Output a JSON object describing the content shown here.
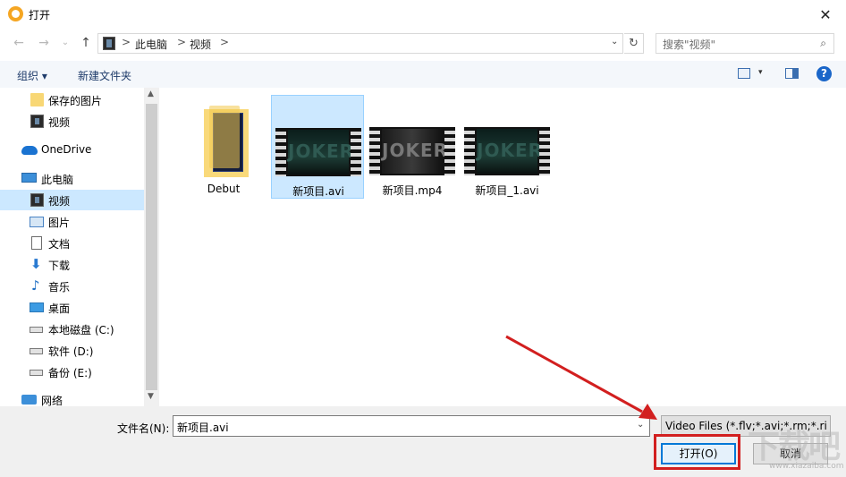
{
  "window": {
    "title": "打开",
    "close_glyph": "✕"
  },
  "addressbar": {
    "back_glyph": "←",
    "forward_glyph": "→",
    "recent_glyph": "⌄",
    "up_glyph": "↑",
    "crumbs": [
      "此电脑",
      "视频"
    ],
    "sep": ">",
    "dropdown_glyph": "⌄",
    "refresh_glyph": "↻"
  },
  "search": {
    "placeholder": "搜索\"视频\"",
    "icon": "search-icon"
  },
  "toolbar": {
    "organize_label": "组织 ▾",
    "new_folder_label": "新建文件夹",
    "view_drop_glyph": "▾",
    "help_label": "?"
  },
  "nav": {
    "items": [
      {
        "label": "保存的图片",
        "icon": "folder-icon"
      },
      {
        "label": "视频",
        "icon": "video-icon"
      },
      {
        "label": "OneDrive",
        "icon": "cloud-icon"
      },
      {
        "label": "此电脑",
        "icon": "computer-icon"
      },
      {
        "label": "视频",
        "icon": "video-icon",
        "selected": true
      },
      {
        "label": "图片",
        "icon": "picture-icon"
      },
      {
        "label": "文档",
        "icon": "document-icon"
      },
      {
        "label": "下载",
        "icon": "download-icon",
        "glyph": "⬇"
      },
      {
        "label": "音乐",
        "icon": "music-icon",
        "glyph": "♪"
      },
      {
        "label": "桌面",
        "icon": "desktop-icon"
      },
      {
        "label": "本地磁盘 (C:)",
        "icon": "drive-icon"
      },
      {
        "label": "软件 (D:)",
        "icon": "drive-icon"
      },
      {
        "label": "备份 (E:)",
        "icon": "drive-icon"
      },
      {
        "label": "网络",
        "icon": "network-icon"
      }
    ],
    "scroll_up_glyph": "▲",
    "scroll_down_glyph": "▼"
  },
  "files": [
    {
      "name": "Debut",
      "type": "folder"
    },
    {
      "name": "新项目.avi",
      "type": "video",
      "selected": true,
      "thumb_text": "JOKER"
    },
    {
      "name": "新项目.mp4",
      "type": "video",
      "thumb_text": "JOKER"
    },
    {
      "name": "新项目_1.avi",
      "type": "video",
      "thumb_text": "JOKER"
    }
  ],
  "bottom": {
    "filename_label": "文件名(N):",
    "filename_value": "新项目.avi",
    "filename_drop_glyph": "⌄",
    "filter_value": "Video Files (*.flv;*.avi;*.rm;*.ri",
    "open_label": "打开(O)",
    "cancel_label": "取消"
  },
  "annotation": {
    "color": "#d21f1f"
  },
  "watermark": {
    "text": "下载吧",
    "sub": "www.xiazaiba.com"
  }
}
